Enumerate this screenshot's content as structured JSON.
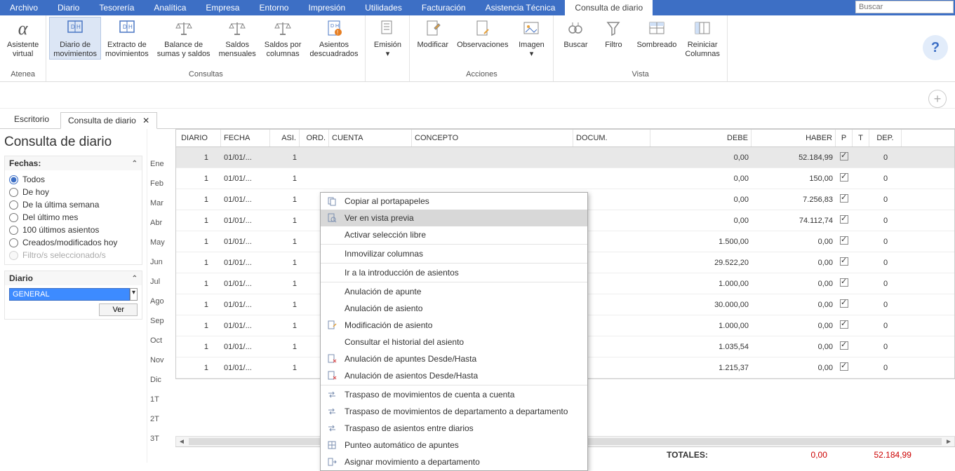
{
  "menubar": {
    "items": [
      "Archivo",
      "Diario",
      "Tesorería",
      "Analítica",
      "Empresa",
      "Entorno",
      "Impresión",
      "Utilidades",
      "Facturación",
      "Asistencia Técnica",
      "Consulta de diario"
    ],
    "active": 10,
    "search_placeholder": "Buscar"
  },
  "ribbon": {
    "groups": [
      {
        "name": "Atenea",
        "buttons": [
          {
            "label": "Asistente\nvirtual",
            "icon": "alpha"
          }
        ]
      },
      {
        "name": "Consultas",
        "buttons": [
          {
            "label": "Diario de\nmovimientos",
            "icon": "doc-dh",
            "active": true
          },
          {
            "label": "Extracto de\nmovimientos",
            "icon": "doc-dh2"
          },
          {
            "label": "Balance de\nsumas y saldos",
            "icon": "scale"
          },
          {
            "label": "Saldos\nmensuales",
            "icon": "scale-cal"
          },
          {
            "label": "Saldos por\ncolumnas",
            "icon": "scale-cols"
          },
          {
            "label": "Asientos\ndescuadrados",
            "icon": "doc-warn"
          }
        ]
      },
      {
        "name": "",
        "buttons": [
          {
            "label": "Emisión\n▾",
            "icon": "doc-send"
          }
        ]
      },
      {
        "name": "Acciones",
        "buttons": [
          {
            "label": "Modificar",
            "icon": "doc-edit"
          },
          {
            "label": "Observaciones",
            "icon": "doc-pen"
          },
          {
            "label": "Imagen\n▾",
            "icon": "image"
          }
        ]
      },
      {
        "name": "Vista",
        "buttons": [
          {
            "label": "Buscar",
            "icon": "binoc"
          },
          {
            "label": "Filtro",
            "icon": "funnel"
          },
          {
            "label": "Sombreado",
            "icon": "grid-shade"
          },
          {
            "label": "Reiniciar\nColumnas",
            "icon": "grid-reset"
          }
        ]
      }
    ]
  },
  "pagetabs": {
    "items": [
      "Escritorio",
      "Consulta de diario"
    ],
    "active": 1
  },
  "page_title": "Consulta de diario",
  "sidebar": {
    "fechas": {
      "title": "Fechas:",
      "options": [
        "Todos",
        "De hoy",
        "De la última semana",
        "Del último mes",
        "100 últimos asientos",
        "Creados/modificados hoy",
        "Filtro/s seleccionado/s"
      ],
      "selected": 0
    },
    "diario": {
      "title": "Diario",
      "value": "GENERAL",
      "ver_label": "Ver"
    }
  },
  "months": [
    "Ene",
    "Feb",
    "Mar",
    "Abr",
    "May",
    "Jun",
    "Jul",
    "Ago",
    "Sep",
    "Oct",
    "Nov",
    "Dic",
    "1T",
    "2T",
    "3T"
  ],
  "grid": {
    "headers": [
      "DIARIO",
      "FECHA",
      "ASI.",
      "ORD.",
      "CUENTA",
      "CONCEPTO",
      "DOCUM.",
      "DEBE",
      "HABER",
      "P",
      "T",
      "DEP."
    ],
    "rows": [
      {
        "diario": "1",
        "fecha": "01/01/...",
        "asi": "1",
        "ord": "",
        "cuenta": "",
        "concepto": "",
        "docum": "",
        "debe": "0,00",
        "haber": "52.184,99",
        "p": true,
        "t": "",
        "dep": "0",
        "sel": true
      },
      {
        "diario": "1",
        "fecha": "01/01/...",
        "asi": "1",
        "ord": "",
        "cuenta": "",
        "concepto": "",
        "docum": "",
        "debe": "0,00",
        "haber": "150,00",
        "p": true,
        "t": "",
        "dep": "0"
      },
      {
        "diario": "1",
        "fecha": "01/01/...",
        "asi": "1",
        "ord": "",
        "cuenta": "",
        "concepto": "",
        "docum": "",
        "debe": "0,00",
        "haber": "7.256,83",
        "p": true,
        "t": "",
        "dep": "0"
      },
      {
        "diario": "1",
        "fecha": "01/01/...",
        "asi": "1",
        "ord": "",
        "cuenta": "",
        "concepto": "",
        "docum": "",
        "debe": "0,00",
        "haber": "74.112,74",
        "p": true,
        "t": "",
        "dep": "0"
      },
      {
        "diario": "1",
        "fecha": "01/01/...",
        "asi": "1",
        "ord": "",
        "cuenta": "",
        "concepto": "",
        "docum": "",
        "debe": "1.500,00",
        "haber": "0,00",
        "p": true,
        "t": "",
        "dep": "0"
      },
      {
        "diario": "1",
        "fecha": "01/01/...",
        "asi": "1",
        "ord": "",
        "cuenta": "",
        "concepto": "",
        "docum": "",
        "debe": "29.522,20",
        "haber": "0,00",
        "p": true,
        "t": "",
        "dep": "0"
      },
      {
        "diario": "1",
        "fecha": "01/01/...",
        "asi": "1",
        "ord": "",
        "cuenta": "",
        "concepto": "",
        "docum": "",
        "debe": "1.000,00",
        "haber": "0,00",
        "p": true,
        "t": "",
        "dep": "0"
      },
      {
        "diario": "1",
        "fecha": "01/01/...",
        "asi": "1",
        "ord": "",
        "cuenta": "",
        "concepto": "",
        "docum": "",
        "debe": "30.000,00",
        "haber": "0,00",
        "p": true,
        "t": "",
        "dep": "0"
      },
      {
        "diario": "1",
        "fecha": "01/01/...",
        "asi": "1",
        "ord": "",
        "cuenta": "",
        "concepto": "",
        "docum": "",
        "debe": "1.000,00",
        "haber": "0,00",
        "p": true,
        "t": "",
        "dep": "0"
      },
      {
        "diario": "1",
        "fecha": "01/01/...",
        "asi": "1",
        "ord": "",
        "cuenta": "",
        "concepto": "",
        "docum": "",
        "debe": "1.035,54",
        "haber": "0,00",
        "p": true,
        "t": "",
        "dep": "0"
      },
      {
        "diario": "1",
        "fecha": "01/01/...",
        "asi": "1",
        "ord": "",
        "cuenta": "",
        "concepto": "",
        "docum": "",
        "debe": "1.215,37",
        "haber": "0,00",
        "p": true,
        "t": "",
        "dep": "0"
      }
    ]
  },
  "totals": {
    "label": "TOTALES:",
    "debe": "0,00",
    "haber": "52.184,99"
  },
  "context_menu": {
    "items": [
      {
        "label": "Copiar al portapapeles",
        "icon": "copy"
      },
      {
        "label": "Ver en vista previa",
        "icon": "preview",
        "hover": true
      },
      {
        "label": "Activar selección libre"
      },
      {
        "sep": true
      },
      {
        "label": "Inmovilizar columnas"
      },
      {
        "sep": true
      },
      {
        "label": "Ir a la introducción de asientos"
      },
      {
        "sep": true
      },
      {
        "label": "Anulación de apunte"
      },
      {
        "label": "Anulación de asiento"
      },
      {
        "label": "Modificación de asiento",
        "icon": "doc-edit-sm"
      },
      {
        "label": "Consultar el historial del asiento"
      },
      {
        "label": "Anulación de apuntes Desde/Hasta",
        "icon": "doc-x"
      },
      {
        "label": "Anulación de asientos Desde/Hasta",
        "icon": "doc-x"
      },
      {
        "sep": true
      },
      {
        "label": "Traspaso de movimientos de cuenta a cuenta",
        "icon": "transfer"
      },
      {
        "label": "Traspaso de movimientos de departamento a departamento",
        "icon": "transfer"
      },
      {
        "label": "Traspaso de asientos entre diarios",
        "icon": "transfer"
      },
      {
        "label": "Punteo automático de apuntes",
        "icon": "grid-sm"
      },
      {
        "label": "Asignar movimiento a departamento",
        "icon": "assign"
      }
    ]
  }
}
